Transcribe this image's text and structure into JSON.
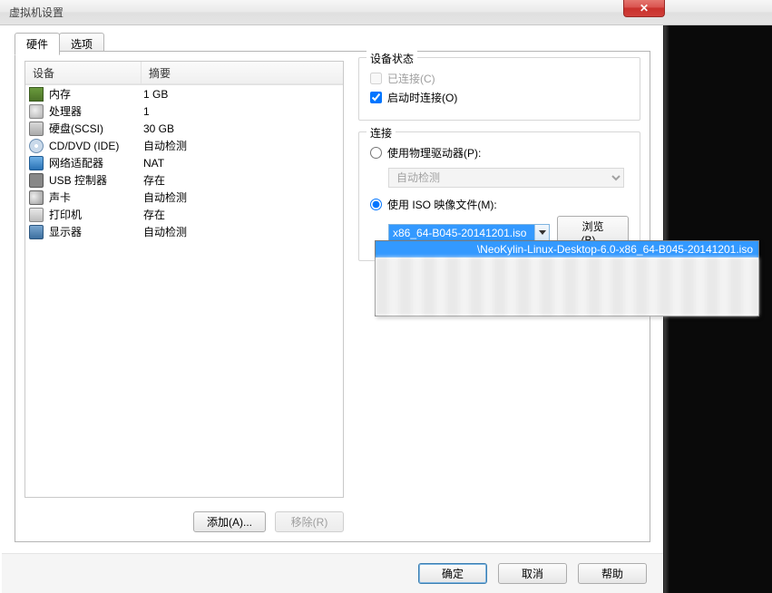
{
  "window": {
    "title": "虚拟机设置",
    "close_glyph": "✕"
  },
  "tabs": {
    "hardware": "硬件",
    "options": "选项"
  },
  "hw_list": {
    "col_device": "设备",
    "col_summary": "摘要",
    "rows": [
      {
        "icon": "ic-mem",
        "name": "内存",
        "summary": "1 GB"
      },
      {
        "icon": "ic-cpu",
        "name": "处理器",
        "summary": "1"
      },
      {
        "icon": "ic-hdd",
        "name": "硬盘(SCSI)",
        "summary": "30 GB"
      },
      {
        "icon": "ic-cd",
        "name": "CD/DVD (IDE)",
        "summary": "自动检测"
      },
      {
        "icon": "ic-net",
        "name": "网络适配器",
        "summary": "NAT"
      },
      {
        "icon": "ic-usb",
        "name": "USB 控制器",
        "summary": "存在"
      },
      {
        "icon": "ic-snd",
        "name": "声卡",
        "summary": "自动检测"
      },
      {
        "icon": "ic-prn",
        "name": "打印机",
        "summary": "存在"
      },
      {
        "icon": "ic-mon",
        "name": "显示器",
        "summary": "自动检测"
      }
    ]
  },
  "buttons": {
    "add": "添加(A)...",
    "remove": "移除(R)",
    "ok": "确定",
    "cancel": "取消",
    "help": "帮助",
    "browse": "浏览(B)..."
  },
  "device_status": {
    "legend": "设备状态",
    "connected": "已连接(C)",
    "connect_at_power_on": "启动时连接(O)"
  },
  "connection": {
    "legend": "连接",
    "use_physical": "使用物理驱动器(P):",
    "physical_select_value": "自动检测",
    "use_iso": "使用 ISO 映像文件(M):",
    "iso_value": "x86_64-B045-20141201.iso",
    "dropdown_item": "\\NeoKylin-Linux-Desktop-6.0-x86_64-B045-20141201.iso"
  }
}
